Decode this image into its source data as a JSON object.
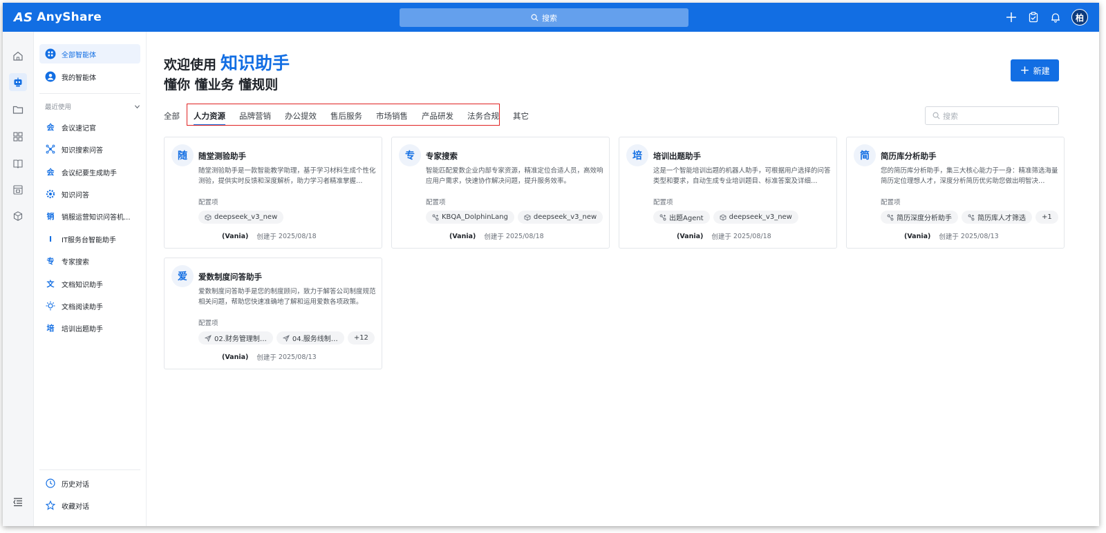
{
  "app": {
    "brand": "AnyShare",
    "brand_mark": "AS",
    "search_placeholder": "搜索",
    "avatar": "柏"
  },
  "sidebar": {
    "top": [
      {
        "label": "全部智能体",
        "icon": "grid-circle-icon"
      },
      {
        "label": "我的智能体",
        "icon": "user-circle-icon"
      }
    ],
    "recent_title": "最近使用",
    "recent": [
      {
        "label": "会议速记官",
        "char": "会"
      },
      {
        "label": "知识搜索问答",
        "char": ""
      },
      {
        "label": "会议纪要生成助手",
        "char": "会"
      },
      {
        "label": "知识问答",
        "char": ""
      },
      {
        "label": "销服运营知识问答机...",
        "char": "销"
      },
      {
        "label": "IT服务台智能助手",
        "char": "I"
      },
      {
        "label": "专家搜索",
        "char": "专"
      },
      {
        "label": "文档知识助手",
        "char": "文"
      },
      {
        "label": "文档阅读助手",
        "char": ""
      },
      {
        "label": "培训出题助手",
        "char": "培"
      }
    ],
    "bottom": [
      {
        "label": "历史对话",
        "icon": "clock-icon"
      },
      {
        "label": "收藏对话",
        "icon": "star-icon"
      }
    ]
  },
  "main": {
    "welcome": "欢迎使用",
    "highlight": "知识助手",
    "subtitle": "懂你 懂业务 懂规则",
    "new_button": "新建",
    "search_placeholder": "搜索",
    "tabs": [
      "全部",
      "人力资源",
      "品牌营销",
      "办公提效",
      "售后服务",
      "市场销售",
      "产品研发",
      "法务合规",
      "其它"
    ],
    "active_tab": "人力资源",
    "config_label": "配置项",
    "created_label": "创建于",
    "cards": [
      {
        "char": "随",
        "title": "随堂测验助手",
        "desc": "随堂测验助手是一款智能教学助理，基于学习材料生成个性化测验，提供实时反馈和深度解析，助力学习者精准掌握…",
        "tags": [
          {
            "icon": "cube-icon",
            "text": "deepseek_v3_new"
          }
        ],
        "owner": "(Vania)",
        "date": "2025/08/18"
      },
      {
        "char": "专",
        "title": "专家搜索",
        "desc": "智能匹配爱数企业内部专家资源，精准定位合适人员，高效响应用户需求，快速协作解决问题，提升服务效率。",
        "tags": [
          {
            "icon": "agent-icon",
            "text": "KBQA_DolphinLang"
          },
          {
            "icon": "cube-icon",
            "text": "deepseek_v3_new"
          }
        ],
        "owner": "(Vania)",
        "date": "2025/08/18"
      },
      {
        "char": "培",
        "title": "培训出题助手",
        "desc": "这是一个智能培训出题的机器人助手，可根据用户选择的问答类型和要求，自动生成专业培训题目、标准答案及详细…",
        "tags": [
          {
            "icon": "agent-icon",
            "text": "出题Agent"
          },
          {
            "icon": "cube-icon",
            "text": "deepseek_v3_new"
          }
        ],
        "owner": "(Vania)",
        "date": "2025/08/18"
      },
      {
        "char": "简",
        "title": "简历库分析助手",
        "desc": "您的简历库分析助手，集三大核心能力于一身：精准筛选海量简历定位理想人才，深度分析简历优劣助您做出明智决…",
        "tags": [
          {
            "icon": "agent-icon",
            "text": "简历深度分析助手"
          },
          {
            "icon": "agent-icon",
            "text": "简历库人才筛选"
          },
          {
            "icon": "",
            "text": "+1"
          }
        ],
        "owner": "(Vania)",
        "date": "2025/08/13"
      },
      {
        "char": "爱",
        "title": "爱数制度问答助手",
        "desc": "爱数制度问答助手是您的制度顾问，致力于解答公司制度规范相关问题，帮助您快速准确地了解和运用爱数各项政策。",
        "tags": [
          {
            "icon": "send-icon",
            "text": "02.财务管理制…"
          },
          {
            "icon": "send-icon",
            "text": "04.服务线制…"
          },
          {
            "icon": "",
            "text": "+12"
          }
        ],
        "owner": "(Vania)",
        "date": "2025/08/13"
      }
    ]
  },
  "colors": {
    "brand": "#126ee3",
    "highlight_box": "#e02020"
  }
}
